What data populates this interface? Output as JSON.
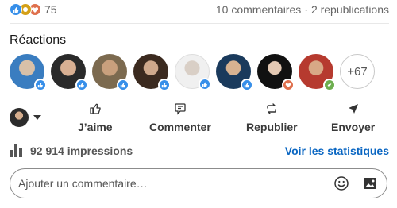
{
  "social_counts": {
    "reactions": "75",
    "comments": "10 commentaires",
    "separator": "·",
    "reposts": "2 republications"
  },
  "reactions_section": {
    "title": "Réactions",
    "more_count": "+67"
  },
  "actions": {
    "like": "J’aime",
    "comment": "Commenter",
    "repost": "Republier",
    "send": "Envoyer"
  },
  "impressions": {
    "text": "92 914 impressions",
    "stats_link": "Voir les statistiques"
  },
  "comment_box": {
    "placeholder": "Ajouter un commentaire…"
  },
  "colors": {
    "accent": "#0a66c2",
    "like": "#378fe9",
    "love": "#df704d"
  }
}
